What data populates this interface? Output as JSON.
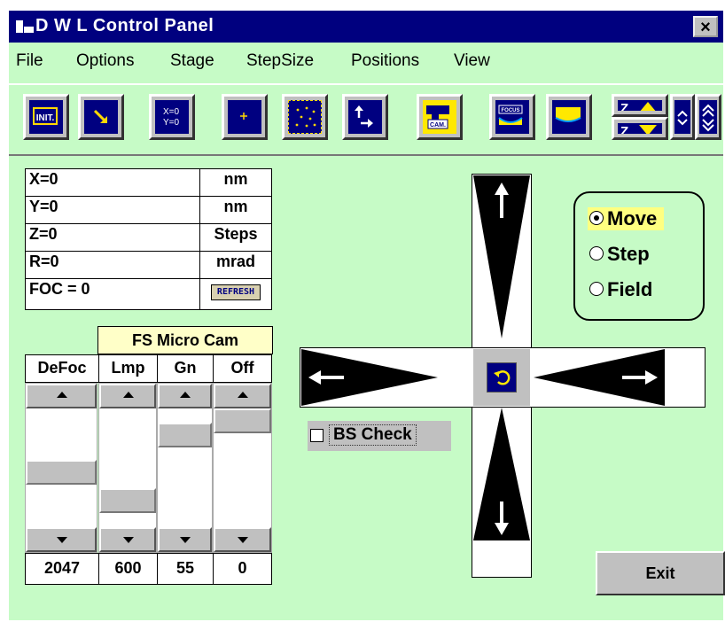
{
  "window": {
    "title": "D W L  Control Panel",
    "close_label": "×"
  },
  "menu": [
    "File",
    "Options",
    "Stage",
    "StepSize",
    "Positions",
    "View"
  ],
  "toolbar": {
    "buttons": [
      {
        "name": "init-button",
        "icon": "init-icon",
        "label": "INIT."
      },
      {
        "name": "home-diagonal-button",
        "icon": "diagonal-arrow-icon"
      },
      {
        "name": "set-zero-button",
        "icon": "xy-zero-icon",
        "label_x": "X=0",
        "label_y": "Y=0"
      },
      {
        "name": "center-point-button",
        "icon": "plus-icon",
        "label": "+"
      },
      {
        "name": "grid-points-button",
        "icon": "dots-grid-icon"
      },
      {
        "name": "move-corner-button",
        "icon": "corner-arrows-icon"
      },
      {
        "name": "camera-button",
        "icon": "camera-icon",
        "label": "CAM."
      },
      {
        "name": "focus-button",
        "icon": "focus-icon",
        "label": "FOCUS"
      },
      {
        "name": "stage-level-button",
        "icon": "stage-level-icon"
      },
      {
        "name": "z-up-button",
        "icon": "z-up-icon",
        "label": "Z"
      },
      {
        "name": "z-down-button",
        "icon": "z-down-icon",
        "label": "Z"
      },
      {
        "name": "z-step-small-button",
        "icon": "chevron-updown-icon"
      },
      {
        "name": "z-step-large-button",
        "icon": "double-chevron-updown-icon"
      }
    ]
  },
  "positions": [
    {
      "label": "X=0",
      "unit": "nm"
    },
    {
      "label": "Y=0",
      "unit": "nm"
    },
    {
      "label": "Z=0",
      "unit": "Steps"
    },
    {
      "label": "R=0",
      "unit": "mrad"
    },
    {
      "label": "FOC = 0",
      "button": "REFRESH"
    }
  ],
  "camera": {
    "title": "FS Micro Cam",
    "columns": [
      {
        "label": "DeFoc",
        "value": "2047",
        "level": 0.45
      },
      {
        "label": "Lmp",
        "value": "600",
        "level": 0.15
      },
      {
        "label": "Gn",
        "value": "55",
        "level": 0.85
      },
      {
        "label": "Off",
        "value": "0",
        "level": 1.0
      }
    ]
  },
  "bs_check": {
    "label": "BS Check",
    "checked": false
  },
  "mode": {
    "options": [
      {
        "label": "Move",
        "selected": true
      },
      {
        "label": "Step",
        "selected": false
      },
      {
        "label": "Field",
        "selected": false
      }
    ]
  },
  "exit_label": "Exit",
  "colors": {
    "background": "#c6fbc6",
    "title_bar": "#00007f",
    "button_face": "#000080",
    "highlight": "#ffff80"
  }
}
